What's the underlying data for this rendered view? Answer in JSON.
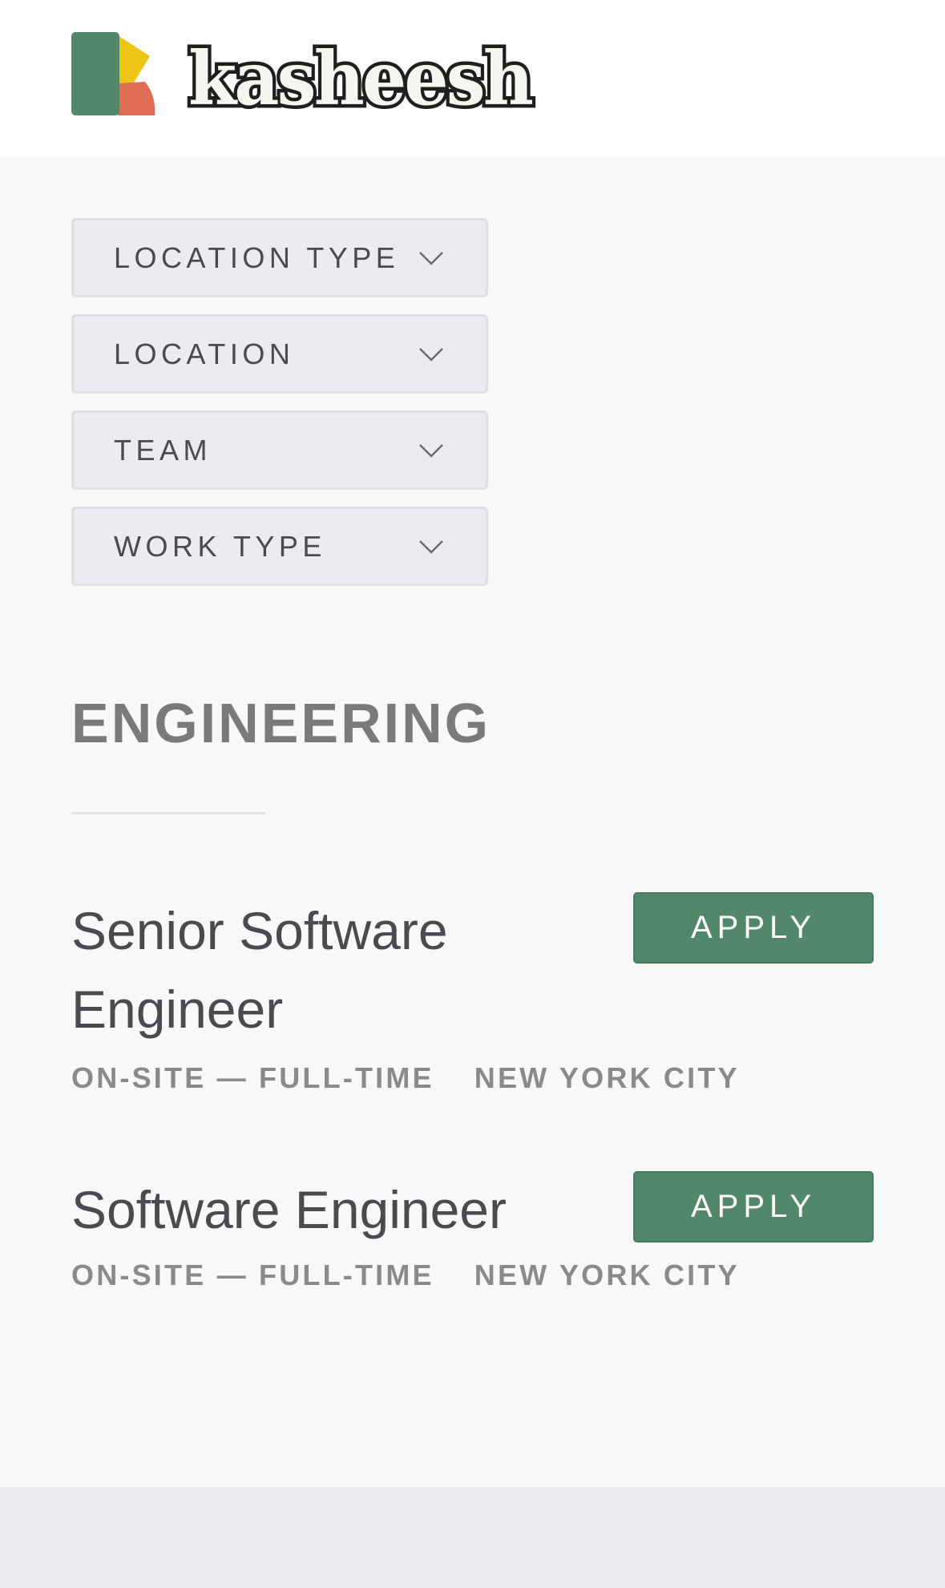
{
  "brand": {
    "name": "kasheesh",
    "logo_colors": {
      "green": "#52876a",
      "yellow": "#eec515",
      "coral": "#e06b55"
    }
  },
  "filters": [
    {
      "label": "LOCATION TYPE",
      "icon": "chevron-down-icon"
    },
    {
      "label": "LOCATION",
      "icon": "chevron-down-icon"
    },
    {
      "label": "TEAM",
      "icon": "chevron-down-icon"
    },
    {
      "label": "WORK TYPE",
      "icon": "chevron-down-icon"
    }
  ],
  "team": {
    "name": "ENGINEERING"
  },
  "postings": [
    {
      "title": "Senior Software Engineer",
      "commitment": "ON-SITE — FULL-TIME",
      "location": "NEW YORK CITY",
      "apply_label": "APPLY"
    },
    {
      "title": "Software Engineer",
      "commitment": "ON-SITE — FULL-TIME",
      "location": "NEW YORK CITY",
      "apply_label": "APPLY"
    }
  ],
  "colors": {
    "accent": "#52876a",
    "page_background": "#f8f8f8",
    "filter_background": "#ebecef"
  }
}
